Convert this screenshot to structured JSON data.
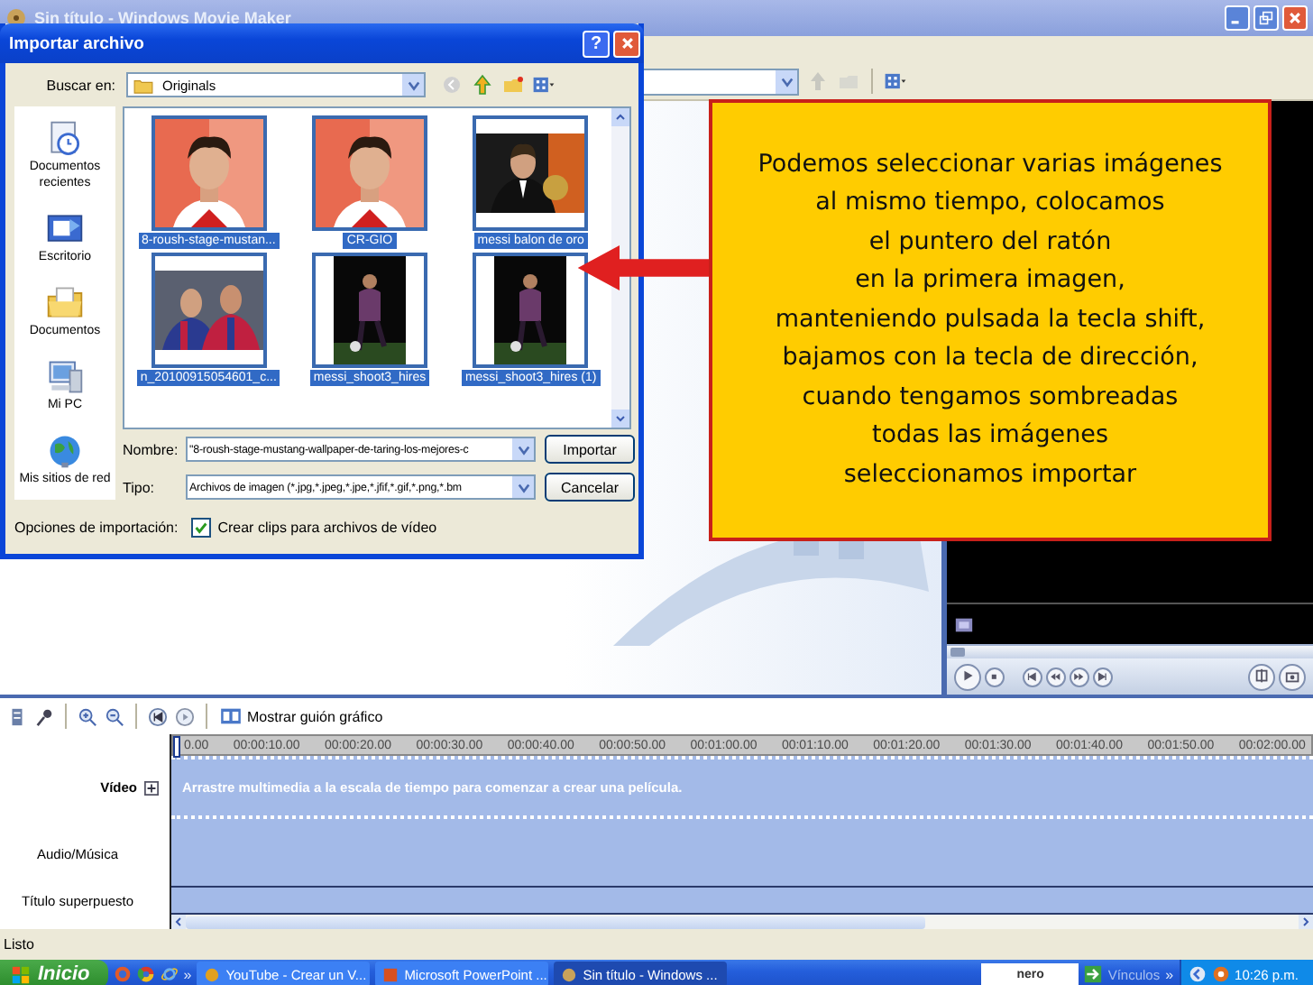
{
  "window": {
    "title": "Sin título - Windows Movie Maker"
  },
  "dialog": {
    "title": "Importar archivo",
    "help": "?",
    "look_in_label": "Buscar en:",
    "look_in_value": "Originals",
    "places": [
      {
        "kind": "recent",
        "label": "Documentos recientes"
      },
      {
        "kind": "desktop",
        "label": "Escritorio"
      },
      {
        "kind": "documents",
        "label": "Documentos"
      },
      {
        "kind": "computer",
        "label": "Mi PC"
      },
      {
        "kind": "network",
        "label": "Mis sitios de red"
      }
    ],
    "files": [
      {
        "name": "8-roush-stage-mustan...",
        "selected": true
      },
      {
        "name": "CR-GIO",
        "selected": true
      },
      {
        "name": "messi balon de oro",
        "selected": true
      },
      {
        "name": "n_20100915054601_c...",
        "selected": true
      },
      {
        "name": "messi_shoot3_hires",
        "selected": true
      },
      {
        "name": "messi_shoot3_hires (1)",
        "selected": true
      }
    ],
    "name_label": "Nombre:",
    "name_value": "\"8-roush-stage-mustang-wallpaper-de-taring-los-mejores-c",
    "type_label": "Tipo:",
    "type_value": "Archivos de imagen (*.jpg,*.jpeg,*.jpe,*.jfif,*.gif,*.png,*.bm",
    "buttons": [
      "Importar",
      "Cancelar"
    ],
    "options_label": "Opciones de importación:",
    "option": {
      "label": "Crear clips para archivos de vídeo",
      "checked": true
    }
  },
  "callout": {
    "lines": [
      "Podemos seleccionar varias imágenes",
      "al mismo tiempo, colocamos",
      "el puntero del ratón",
      "en la primera imagen,",
      "manteniendo pulsada la tecla shift,",
      "bajamos con la tecla de dirección,",
      "cuando tengamos sombreadas",
      "todas las imágenes",
      "seleccionamos importar"
    ]
  },
  "timeline": {
    "storyboard_button": "Mostrar guión gráfico",
    "ruler": [
      "0.00",
      "00:00:10.00",
      "00:00:20.00",
      "00:00:30.00",
      "00:00:40.00",
      "00:00:50.00",
      "00:01:00.00",
      "00:01:10.00",
      "00:01:20.00",
      "00:01:30.00",
      "00:01:40.00",
      "00:01:50.00",
      "00:02:00.00"
    ],
    "tracks": [
      {
        "label": "Vídeo",
        "hint": "Arrastre multimedia a la escala de tiempo para comenzar a crear una película."
      },
      {
        "label": "Audio/Música"
      },
      {
        "label": "Título superpuesto"
      }
    ]
  },
  "status_bar": "Listo",
  "taskbar": {
    "start": "Inicio",
    "more": "»",
    "tasks": [
      {
        "label": "YouTube - Crear un V...",
        "selected": false
      },
      {
        "label": "Microsoft PowerPoint ...",
        "selected": false
      },
      {
        "label": "Sin título - Windows ...",
        "selected": true
      }
    ],
    "nero": "nero",
    "links": "Vínculos",
    "links_more": "»",
    "clock": "10:26 p.m."
  }
}
